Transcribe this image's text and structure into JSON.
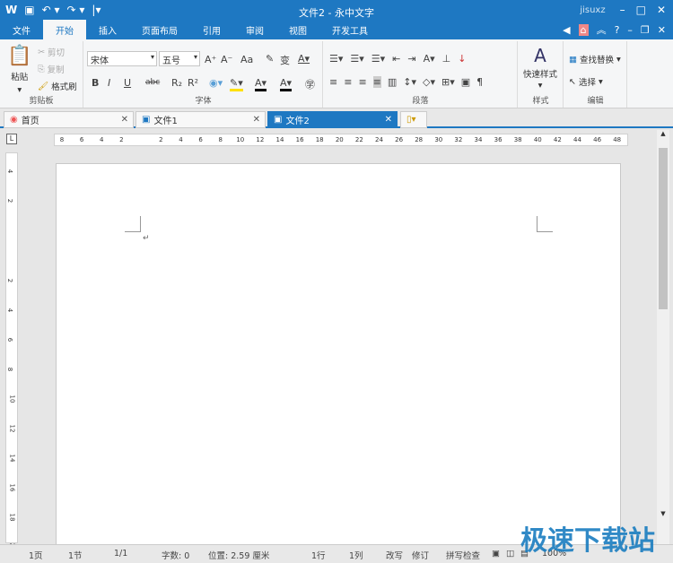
{
  "window": {
    "title": "文件2 - 永中文字",
    "user": "jisuxz"
  },
  "menu_tabs": [
    "文件",
    "开始",
    "插入",
    "页面布局",
    "引用",
    "审阅",
    "视图",
    "开发工具"
  ],
  "ribbon": {
    "clipboard": {
      "paste": "粘贴",
      "cut": "剪切",
      "copy": "复制",
      "format_painter": "格式刷",
      "label": "剪贴板"
    },
    "font": {
      "font_name": "宋体",
      "font_size": "五号",
      "label": "字体",
      "bold": "B",
      "italic": "I",
      "underline": "U",
      "strike": "abc",
      "sub": "R₂",
      "sup": "R²",
      "grow": "A⁺",
      "shrink": "A⁻",
      "case": "Aa"
    },
    "paragraph": {
      "label": "段落"
    },
    "styles": {
      "quick_styles": "快速样式",
      "label": "样式"
    },
    "editing": {
      "find_replace": "查找替换",
      "select": "选择",
      "label": "编辑"
    }
  },
  "doc_tabs": [
    {
      "label": "首页"
    },
    {
      "label": "文件1"
    },
    {
      "label": "文件2",
      "active": true
    }
  ],
  "hruler": [
    "8",
    "6",
    "4",
    "2",
    "2",
    "4",
    "6",
    "8",
    "10",
    "12",
    "14",
    "16",
    "18",
    "20",
    "22",
    "24",
    "26",
    "28",
    "30",
    "32",
    "34",
    "36",
    "38",
    "40",
    "42",
    "44",
    "46",
    "48"
  ],
  "vruler": [
    "4",
    "2",
    "2",
    "4",
    "6",
    "8",
    "10",
    "12",
    "14",
    "16",
    "18",
    "20"
  ],
  "status": {
    "page": "1页",
    "section": "1节",
    "pages": "1/1",
    "words": "字数: 0",
    "position": "位置: 2.59 厘米",
    "line": "1行",
    "column": "1列",
    "overtype": "改写",
    "track": "修订",
    "spell": "拼写检查",
    "zoom": "100%"
  },
  "zoom_level_percent": 100,
  "watermark": "极速下载站",
  "colors": {
    "accent": "#1e78c2"
  }
}
